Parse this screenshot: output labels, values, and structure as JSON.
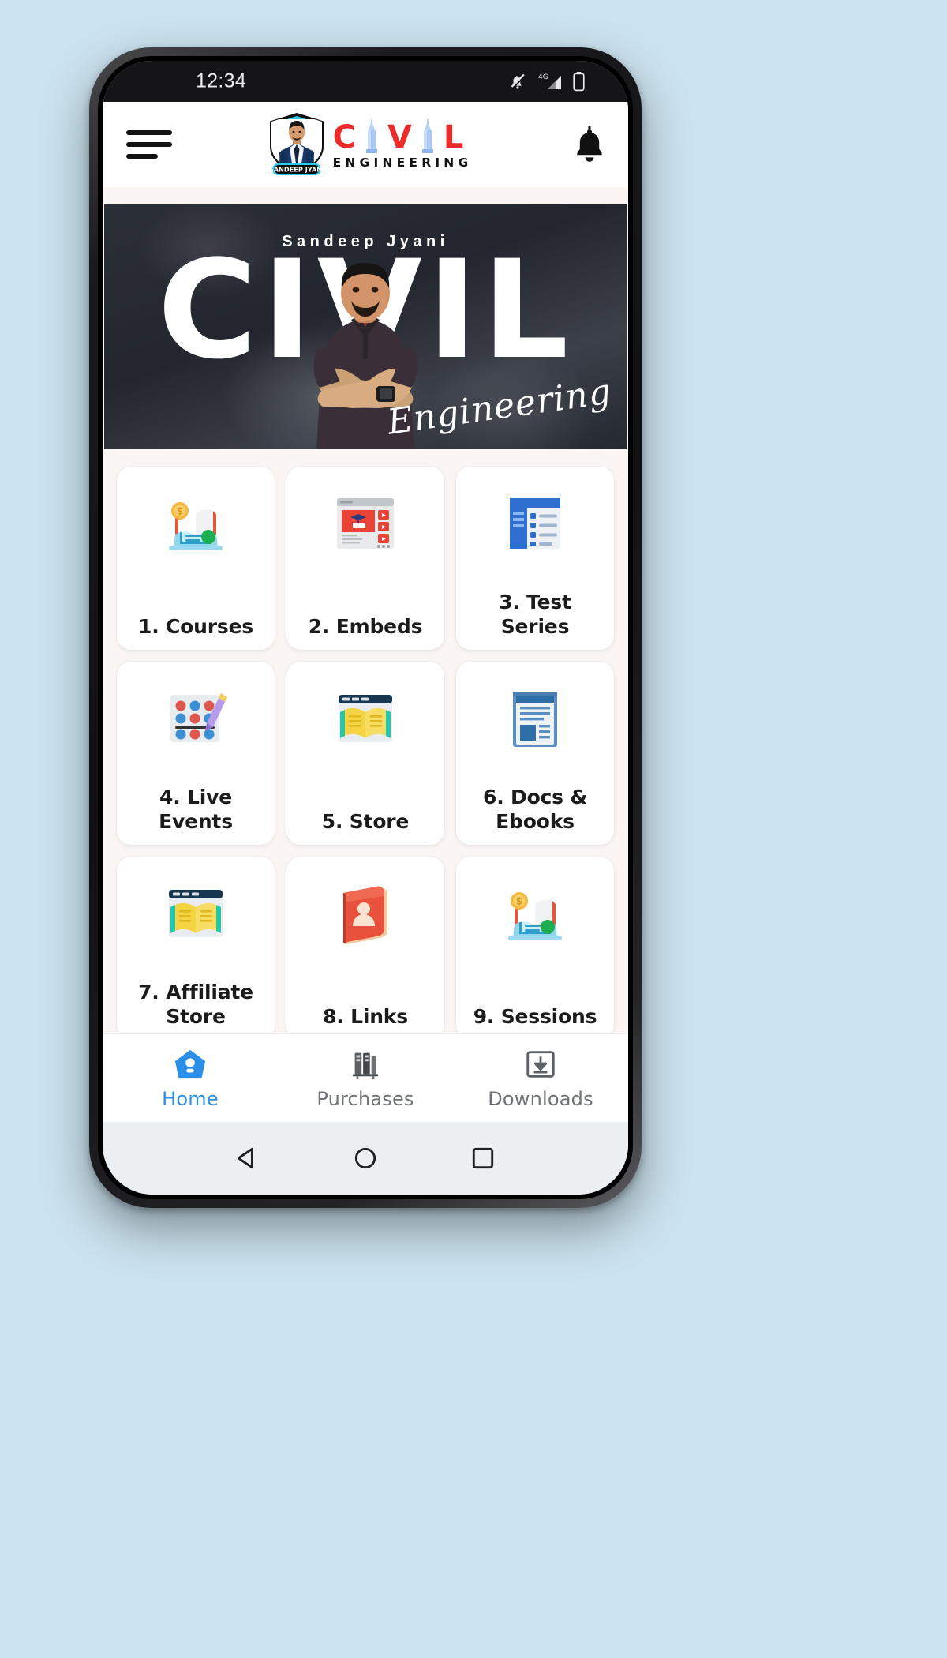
{
  "status_bar": {
    "time": "12:34",
    "icons": [
      "notifications-muted-icon",
      "mobile-network-4g-icon",
      "battery-icon"
    ],
    "network_label": "4G"
  },
  "header": {
    "menu_icon": "hamburger-menu-icon",
    "logo": {
      "badge_name": "SANDEEP JYANI",
      "word_top": "CIVIL",
      "letters": [
        "C",
        "I",
        "V",
        "I",
        "L"
      ],
      "word_bottom": "ENGINEERING",
      "accent_color": "#ee2b2b",
      "tower_color": "#8fb6f0"
    },
    "notification_icon": "bell-icon"
  },
  "banner": {
    "eyebrow": "Sandeep Jyani",
    "headline": "CIVIL",
    "script": "Engineering",
    "background_color": "#2b2f38"
  },
  "grid": {
    "tiles": [
      {
        "label": "1. Courses",
        "icon": "online-course-laptop-book-icon"
      },
      {
        "label": "2. Embeds",
        "icon": "embedded-video-page-icon"
      },
      {
        "label": "3. Test Series",
        "icon": "test-series-checklist-icon"
      },
      {
        "label": "4. Live Events",
        "icon": "live-events-quiz-board-icon"
      },
      {
        "label": "5. Store",
        "icon": "store-open-book-window-icon"
      },
      {
        "label": "6. Docs & Ebooks",
        "icon": "docs-ebooks-document-icon"
      },
      {
        "label": "7. Affiliate Store",
        "icon": "affiliate-store-book-window-icon"
      },
      {
        "label": "8. Links",
        "icon": "links-red-book-icon"
      },
      {
        "label": "9. Sessions",
        "icon": "sessions-laptop-book-icon"
      }
    ]
  },
  "bottom_nav": {
    "items": [
      {
        "label": "Home",
        "icon": "home-icon",
        "active": true
      },
      {
        "label": "Purchases",
        "icon": "books-icon",
        "active": false
      },
      {
        "label": "Downloads",
        "icon": "download-box-icon",
        "active": false
      }
    ],
    "active_color": "#2b8fe8",
    "inactive_color": "#6e7276"
  },
  "system_nav": {
    "buttons": [
      "back-triangle-icon",
      "home-circle-icon",
      "recents-square-icon"
    ]
  }
}
